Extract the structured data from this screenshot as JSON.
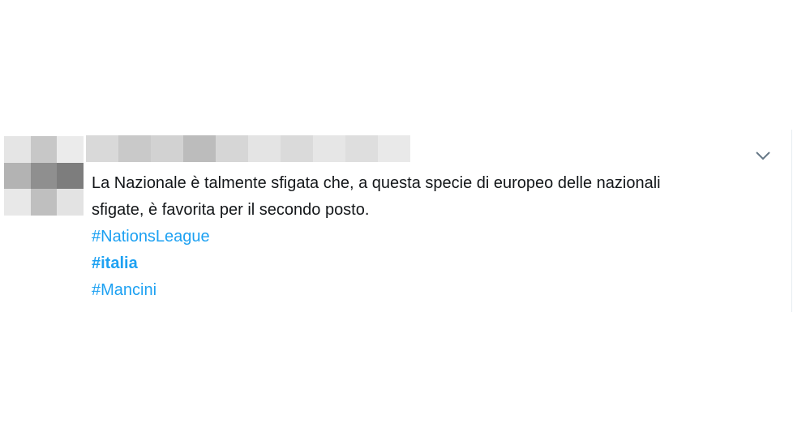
{
  "tweet": {
    "text_line1": "La Nazionale è talmente sfigata che, a questa specie di europeo delle nazionali",
    "text_line2": "sfigate, è favorita per il secondo posto.",
    "hashtags": [
      "#NationsLeague",
      "#italia",
      "#Mancini"
    ],
    "hashtag_color": "#1da1f2",
    "text_color": "#14171a"
  },
  "icons": {
    "menu": "chevron-down-icon",
    "avatar": "pixelated-avatar"
  }
}
